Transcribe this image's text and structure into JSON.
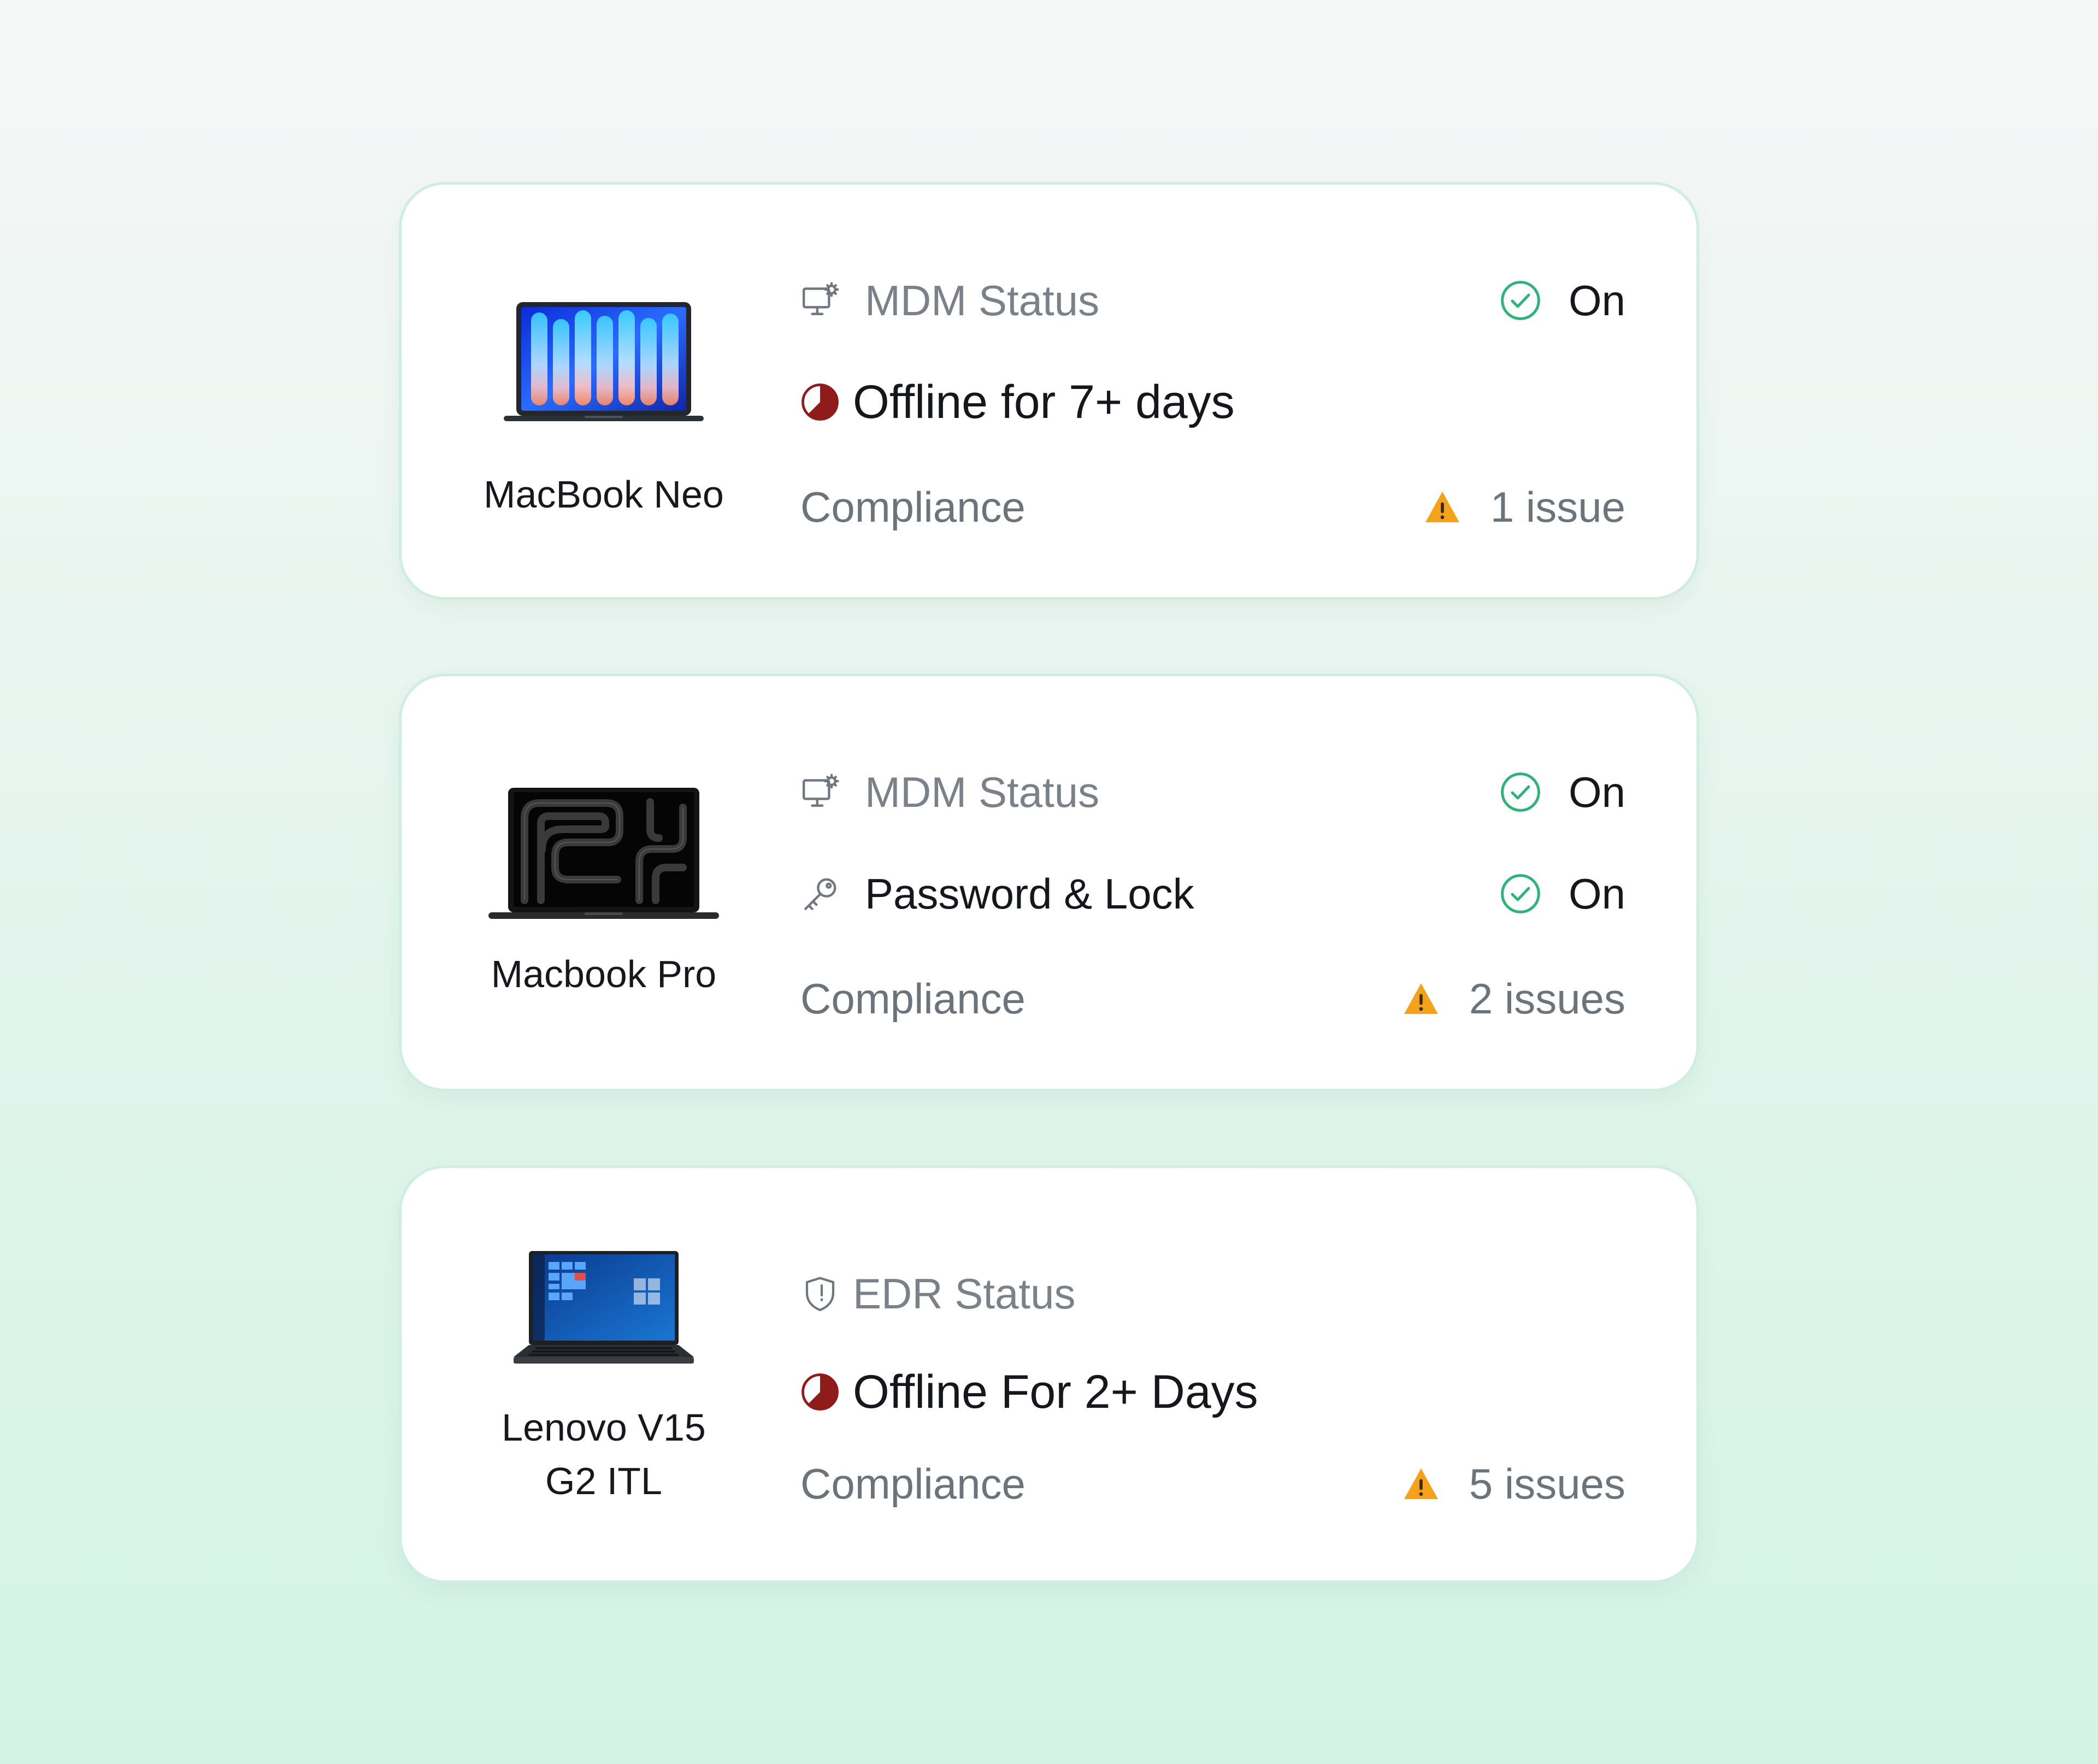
{
  "devices": [
    {
      "name": "MacBook Neo",
      "status_row": {
        "icon": "monitor-gear-icon",
        "label": "MDM Status",
        "value": "On"
      },
      "second_row": {
        "icon": "offline-pie-icon",
        "label": "Offline for 7+ days"
      },
      "compliance": {
        "label": "Compliance",
        "issues": "1 issue"
      }
    },
    {
      "name": "Macbook Pro",
      "status_row": {
        "icon": "monitor-gear-icon",
        "label": "MDM Status",
        "value": "On"
      },
      "second_row": {
        "icon": "key-icon",
        "label": "Password & Lock",
        "value": "On"
      },
      "compliance": {
        "label": "Compliance",
        "issues": "2 issues"
      }
    },
    {
      "name": "Lenovo V15 G2 ITL",
      "name_lines": [
        "Lenovo V15",
        "G2 ITL"
      ],
      "status_row": {
        "icon": "shield-icon",
        "label": "EDR Status"
      },
      "second_row": {
        "icon": "offline-pie-icon",
        "label": "Offline For 2+ Days"
      },
      "compliance": {
        "label": "Compliance",
        "issues": "5 issues"
      }
    }
  ],
  "colors": {
    "success": "#2fb37a",
    "offline": "#8f1b1b",
    "warning": "#f4a21b",
    "card_border": "#cdeee0"
  }
}
